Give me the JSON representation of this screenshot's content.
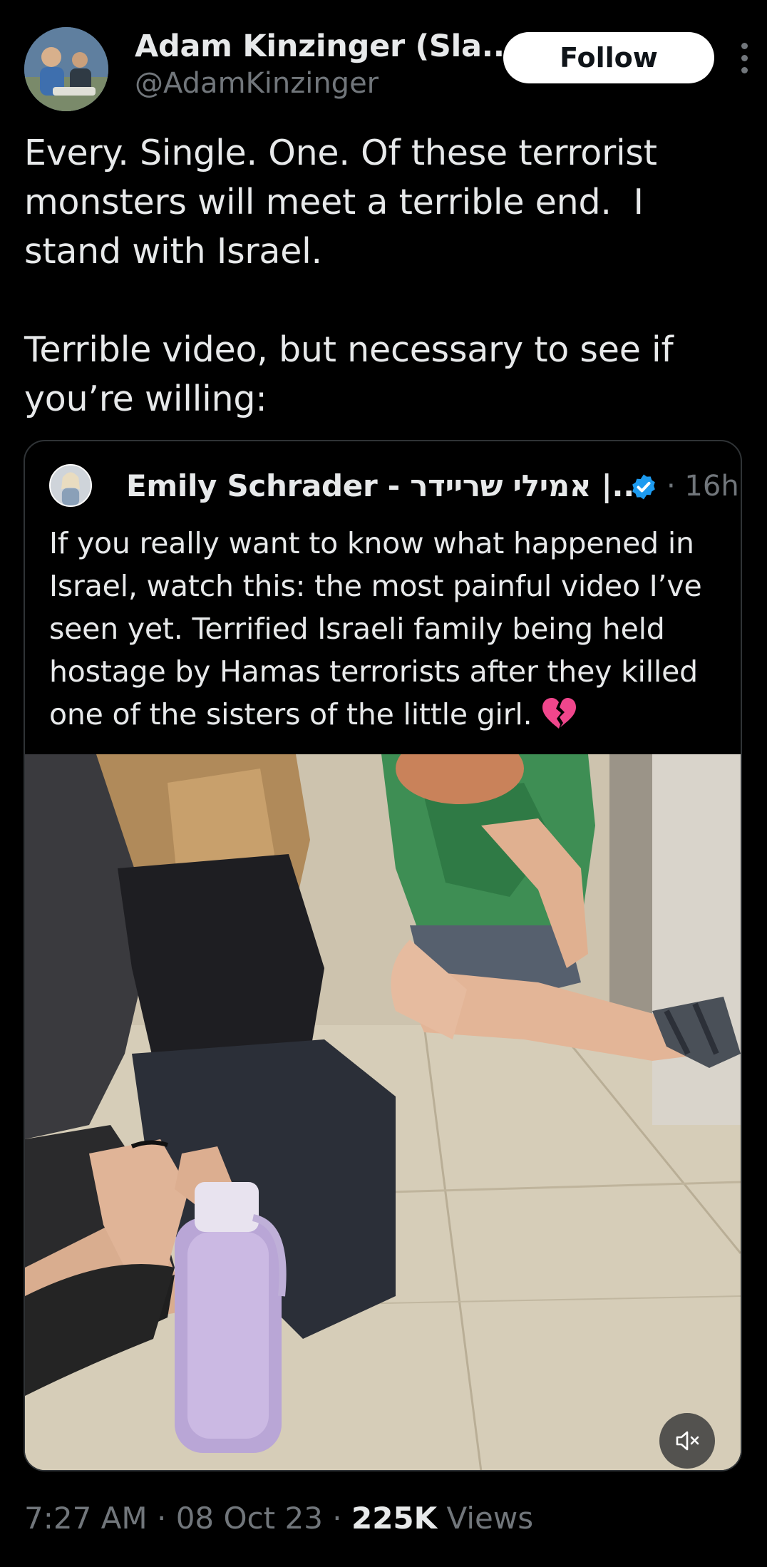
{
  "author": {
    "display_name": "Adam Kinzinger (Sla...",
    "handle": "@AdamKinzinger",
    "follow_label": "Follow",
    "avatar_icon": "profile-photo",
    "more_icon": "more-vertical-icon"
  },
  "tweet": {
    "text": "Every. Single. One. Of these terrorist monsters will meet a terrible end.  I stand with Israel.\n\nTerrible video, but necessary to see if you’re willing:"
  },
  "quote": {
    "display_name": "Emily Schrader - אמילי שריידר |...",
    "verified_icon": "verified-badge-icon",
    "time": "· 16h",
    "text": "If you really want to know what happened in Israel, watch this: the most painful video I’ve seen yet. Terrified Israeli family being held hostage by Hamas terrorists after they killed one of the sisters of the little girl.",
    "emoji": "broken-heart-icon",
    "video": {
      "mute_icon": "volume-muted-icon"
    }
  },
  "meta": {
    "time": "7:27 AM",
    "sep1": " · ",
    "date": "08 Oct 23",
    "sep2": " · ",
    "views_count": "225K",
    "views_label": " Views"
  },
  "colors": {
    "background": "#000000",
    "text_primary": "#e7e9ea",
    "text_secondary": "#71767b",
    "border": "#2f3336",
    "verified_blue": "#1d9bf0",
    "follow_bg": "#ffffff"
  }
}
